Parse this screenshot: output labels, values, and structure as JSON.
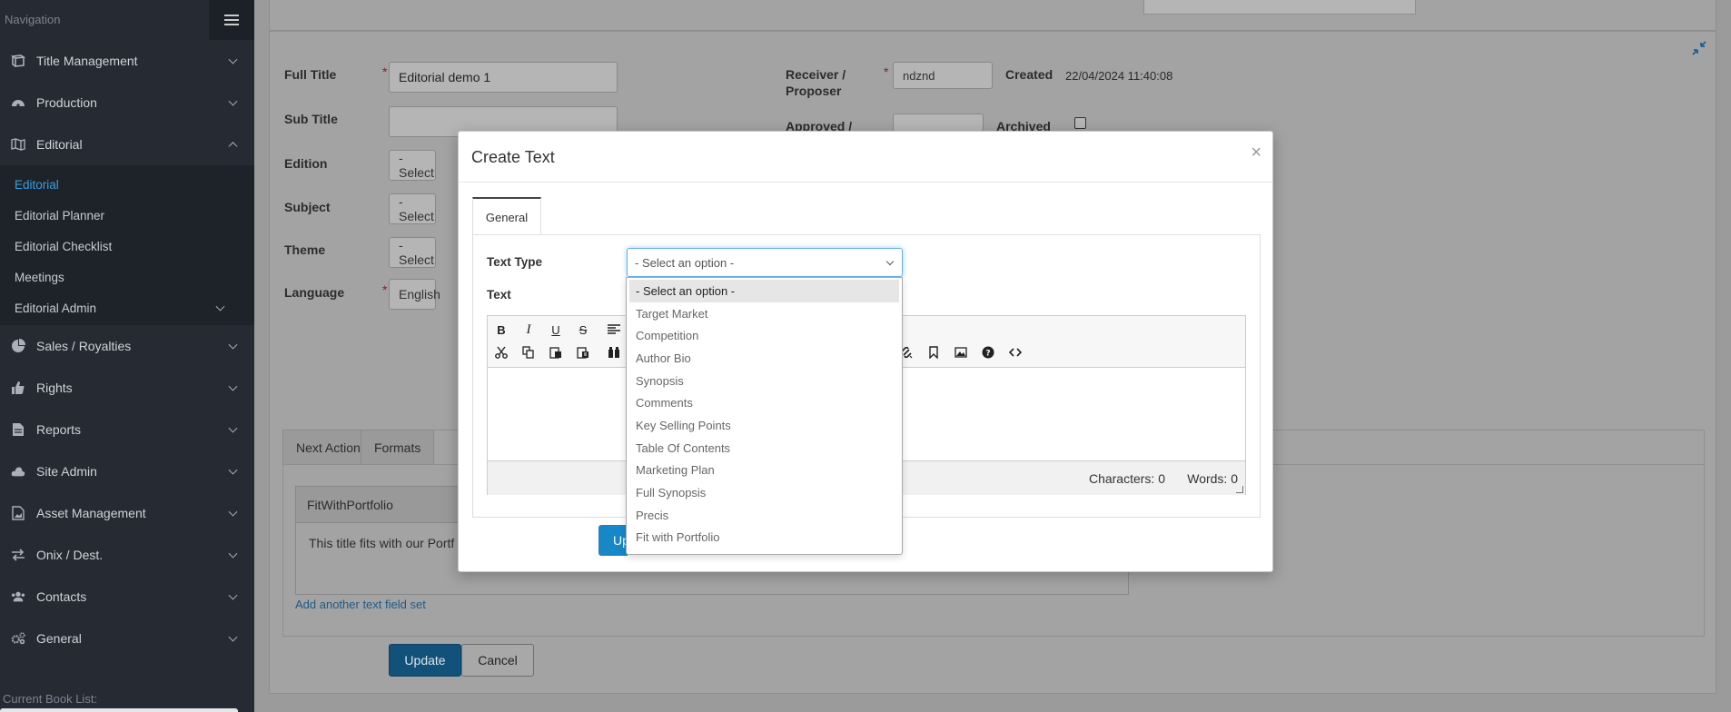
{
  "sidebar": {
    "nav_label": "Navigation",
    "items": [
      {
        "label": "Title Management",
        "icon": "book-icon"
      },
      {
        "label": "Production",
        "icon": "dashboard-icon"
      },
      {
        "label": "Editorial",
        "icon": "map-icon"
      }
    ],
    "editorial_sub": [
      {
        "label": "Editorial"
      },
      {
        "label": "Editorial Planner"
      },
      {
        "label": "Editorial Checklist"
      },
      {
        "label": "Meetings"
      },
      {
        "label": "Editorial Admin"
      }
    ],
    "items2": [
      {
        "label": "Sales / Royalties",
        "icon": "pie-chart-icon"
      },
      {
        "label": "Rights",
        "icon": "thumbs-up-icon"
      },
      {
        "label": "Reports",
        "icon": "file-icon"
      },
      {
        "label": "Site Admin",
        "icon": "cloud-icon"
      },
      {
        "label": "Asset Management",
        "icon": "image-icon"
      },
      {
        "label": "Onix / Dest.",
        "icon": "exchange-icon"
      },
      {
        "label": "Contacts",
        "icon": "users-icon"
      },
      {
        "label": "General",
        "icon": "gears-icon"
      }
    ],
    "current_book_label": "Current Book List:"
  },
  "form": {
    "full_title_label": "Full Title",
    "full_title_value": "Editorial demo 1",
    "sub_title_label": "Sub Title",
    "edition_label": "Edition",
    "subject_label": "Subject",
    "theme_label": "Theme",
    "language_label": "Language",
    "select_short": "- Select",
    "language_value": "English",
    "receiver_label_1": "Receiver /",
    "receiver_label_2": "Proposer",
    "receiver_value": "ndznd",
    "created_label": "Created",
    "created_value": "22/04/2024 11:40:08",
    "approved_label": "Approved /",
    "archived_label": "Archived",
    "required_mark": "*"
  },
  "page_tabs": [
    "Next Action",
    "Formats"
  ],
  "text_card": {
    "title": "FitWithPortfolio",
    "body": "This title fits with our Portf"
  },
  "add_link": "Add another text field set",
  "buttons": {
    "update": "Update",
    "cancel": "Cancel"
  },
  "modal": {
    "title": "Create Text",
    "close": "×",
    "tab": "General",
    "text_type_label": "Text Type",
    "text_label": "Text",
    "select_placeholder": "- Select an option -",
    "characters": "Characters: 0",
    "words": "Words: 0",
    "update_partial": "Up"
  },
  "dropdown_options": [
    "- Select an option -",
    "Target Market",
    "Competition",
    "Author Bio",
    "Synopsis",
    "Comments",
    "Key Selling Points",
    "Table Of Contents",
    "Marketing Plan",
    "Full Synopsis",
    "Precis",
    "Fit with Portfolio"
  ]
}
